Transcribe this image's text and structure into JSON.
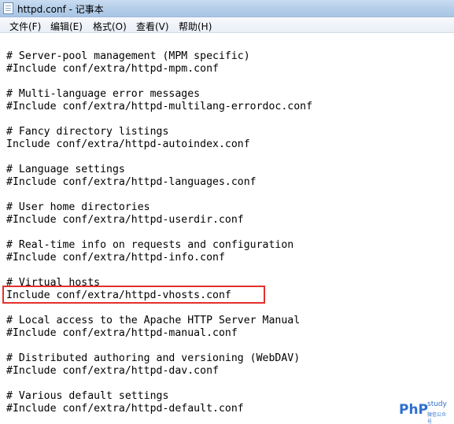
{
  "window": {
    "title": "httpd.conf - 记事本"
  },
  "menu": {
    "items": [
      {
        "label": "文件(F)"
      },
      {
        "label": "编辑(E)"
      },
      {
        "label": "格式(O)"
      },
      {
        "label": "查看(V)"
      },
      {
        "label": "帮助(H)"
      }
    ]
  },
  "editor": {
    "lines": [
      "# Server-pool management (MPM specific)",
      "#Include conf/extra/httpd-mpm.conf",
      "# Multi-language error messages",
      "#Include conf/extra/httpd-multilang-errordoc.conf",
      "# Fancy directory listings",
      "Include conf/extra/httpd-autoindex.conf",
      "# Language settings",
      "#Include conf/extra/httpd-languages.conf",
      "# User home directories",
      "#Include conf/extra/httpd-userdir.conf",
      "# Real-time info on requests and configuration",
      "#Include conf/extra/httpd-info.conf",
      "# Virtual hosts",
      "Include conf/extra/httpd-vhosts.conf",
      "# Local access to the Apache HTTP Server Manual",
      "#Include conf/extra/httpd-manual.conf",
      "# Distributed authoring and versioning (WebDAV)",
      "#Include conf/extra/httpd-dav.conf",
      "# Various default settings",
      "#Include conf/extra/httpd-default.conf"
    ]
  },
  "watermark": {
    "brand": "PhP",
    "word": "study",
    "sub": "微信公众号"
  },
  "colors": {
    "highlight": "#e3302b",
    "watermark": "#2f6fd0"
  }
}
